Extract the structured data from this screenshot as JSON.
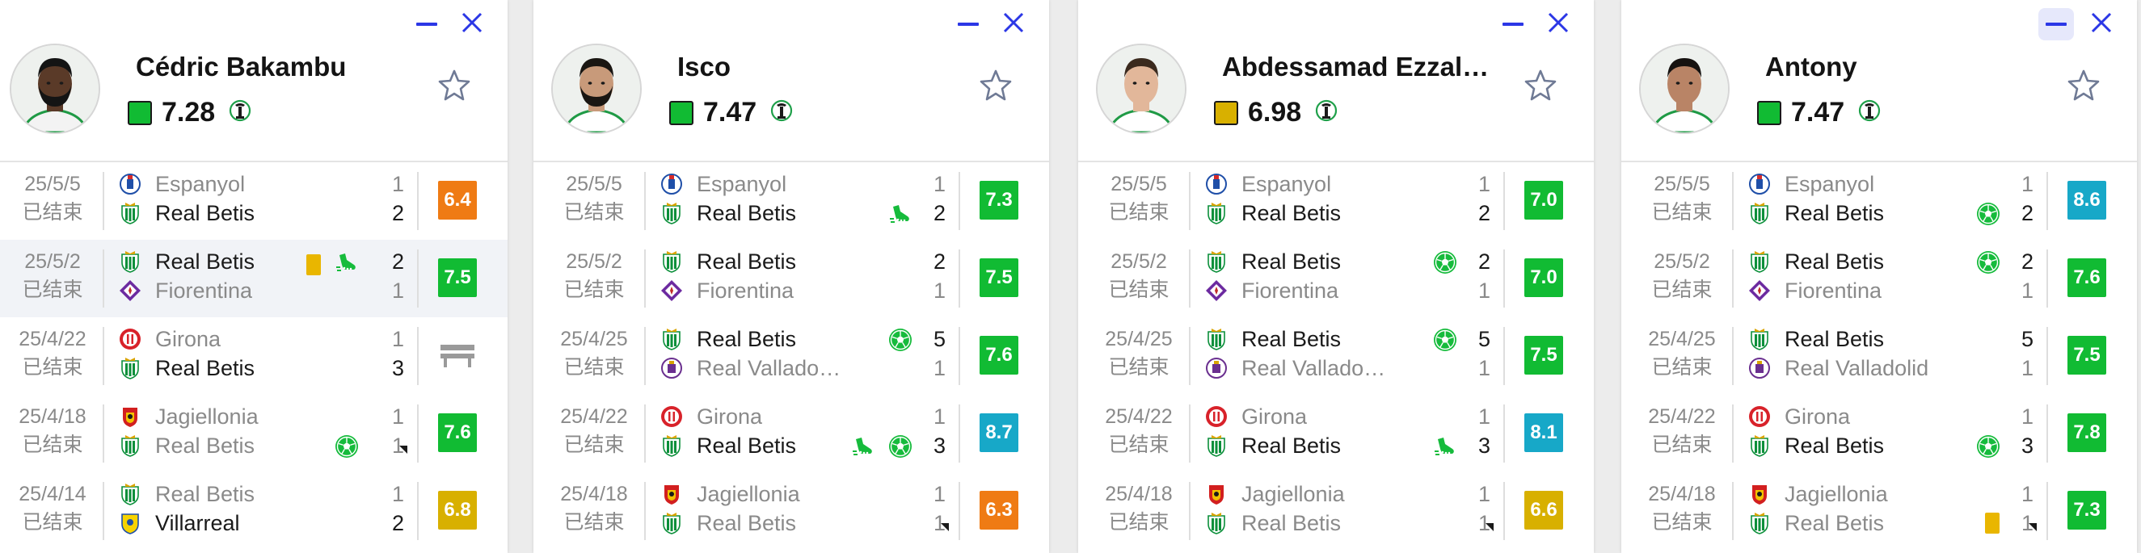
{
  "colors": {
    "green": "#11bb33",
    "bright_green": "#16bb3c",
    "teal": "#17a8c8",
    "orange": "#ef7b14",
    "yellow": "#d8b000",
    "yellow_card": "#e9b600",
    "accent_blue": "#2b37e6",
    "bench_gray": "#9a9a9a"
  },
  "icons": {
    "minimize": "minimize-icon",
    "close": "close-icon",
    "favorite": "star-outline-icon",
    "league": "conference-league-icon",
    "goal": "goal-ball-icon",
    "assist": "boot-assist-icon",
    "yellow_card": "yellow-card-icon",
    "bench": "bench-icon",
    "penalty_corner": "corner-flag-icon"
  },
  "players": [
    {
      "name": "Cédric Bakambu",
      "rating": "7.28",
      "rating_color": "#11bb33",
      "matches": [
        {
          "date": "25/5/5",
          "status": "已结束",
          "home": "Espanyol",
          "away": "Real Betis",
          "home_score": "1",
          "away_score": "2",
          "home_strong": false,
          "away_strong": true,
          "rating": "6.4",
          "badge_color": "#ef7b14",
          "events": [],
          "corner": false,
          "highlight": false
        },
        {
          "date": "25/5/2",
          "status": "已结束",
          "home": "Real Betis",
          "away": "Fiorentina",
          "home_score": "2",
          "away_score": "1",
          "home_strong": true,
          "away_strong": false,
          "rating": "7.5",
          "badge_color": "#11bb33",
          "events": [
            "yellow_card",
            "assist"
          ],
          "corner": false,
          "highlight": true
        },
        {
          "date": "25/4/22",
          "status": "已结束",
          "home": "Girona",
          "away": "Real Betis",
          "home_score": "1",
          "away_score": "3",
          "home_strong": false,
          "away_strong": true,
          "rating": "",
          "badge_color": "",
          "bench": true,
          "events": [],
          "corner": false,
          "highlight": false
        },
        {
          "date": "25/4/18",
          "status": "已结束",
          "home": "Jagiellonia",
          "away": "Real Betis",
          "home_score": "1",
          "away_score": "1",
          "home_strong": false,
          "away_strong": false,
          "rating": "7.6",
          "badge_color": "#11bb33",
          "events": [
            "goal"
          ],
          "corner": true,
          "highlight": false
        },
        {
          "date": "25/4/14",
          "status": "已结束",
          "home": "Real Betis",
          "away": "Villarreal",
          "home_score": "1",
          "away_score": "2",
          "home_strong": false,
          "away_strong": true,
          "rating": "6.8",
          "badge_color": "#d8b000",
          "events": [],
          "corner": false,
          "highlight": false
        }
      ]
    },
    {
      "name": "Isco",
      "rating": "7.47",
      "rating_color": "#11bb33",
      "matches": [
        {
          "date": "25/5/5",
          "status": "已结束",
          "home": "Espanyol",
          "away": "Real Betis",
          "home_score": "1",
          "away_score": "2",
          "home_strong": false,
          "away_strong": true,
          "rating": "7.3",
          "badge_color": "#11bb33",
          "events": [
            "assist"
          ],
          "corner": false,
          "highlight": false
        },
        {
          "date": "25/5/2",
          "status": "已结束",
          "home": "Real Betis",
          "away": "Fiorentina",
          "home_score": "2",
          "away_score": "1",
          "home_strong": true,
          "away_strong": false,
          "rating": "7.5",
          "badge_color": "#11bb33",
          "events": [],
          "corner": false,
          "highlight": false
        },
        {
          "date": "25/4/25",
          "status": "已结束",
          "home": "Real Betis",
          "away": "Real Vallado…",
          "home_score": "5",
          "away_score": "1",
          "home_strong": true,
          "away_strong": false,
          "rating": "7.6",
          "badge_color": "#11bb33",
          "events": [
            "goal_top"
          ],
          "corner": false,
          "highlight": false
        },
        {
          "date": "25/4/22",
          "status": "已结束",
          "home": "Girona",
          "away": "Real Betis",
          "home_score": "1",
          "away_score": "3",
          "home_strong": false,
          "away_strong": true,
          "rating": "8.7",
          "badge_color": "#17a8c8",
          "events": [
            "assist",
            "goal"
          ],
          "corner": false,
          "highlight": false
        },
        {
          "date": "25/4/18",
          "status": "已结束",
          "home": "Jagiellonia",
          "away": "Real Betis",
          "home_score": "1",
          "away_score": "1",
          "home_strong": false,
          "away_strong": false,
          "rating": "6.3",
          "badge_color": "#ef7b14",
          "events": [],
          "corner": true,
          "highlight": false
        }
      ]
    },
    {
      "name": "Abdessamad Ezzal…",
      "rating": "6.98",
      "rating_color": "#d8b000",
      "matches": [
        {
          "date": "25/5/5",
          "status": "已结束",
          "home": "Espanyol",
          "away": "Real Betis",
          "home_score": "1",
          "away_score": "2",
          "home_strong": false,
          "away_strong": true,
          "rating": "7.0",
          "badge_color": "#11bb33",
          "events": [],
          "corner": false,
          "highlight": false
        },
        {
          "date": "25/5/2",
          "status": "已结束",
          "home": "Real Betis",
          "away": "Fiorentina",
          "home_score": "2",
          "away_score": "1",
          "home_strong": true,
          "away_strong": false,
          "rating": "7.0",
          "badge_color": "#11bb33",
          "events": [
            "goal_top"
          ],
          "corner": false,
          "highlight": false
        },
        {
          "date": "25/4/25",
          "status": "已结束",
          "home": "Real Betis",
          "away": "Real Vallado…",
          "home_score": "5",
          "away_score": "1",
          "home_strong": true,
          "away_strong": false,
          "rating": "7.5",
          "badge_color": "#11bb33",
          "events": [
            "goal_top"
          ],
          "corner": false,
          "highlight": false
        },
        {
          "date": "25/4/22",
          "status": "已结束",
          "home": "Girona",
          "away": "Real Betis",
          "home_score": "1",
          "away_score": "3",
          "home_strong": false,
          "away_strong": true,
          "rating": "8.1",
          "badge_color": "#17a8c8",
          "events": [
            "assist"
          ],
          "corner": false,
          "highlight": false
        },
        {
          "date": "25/4/18",
          "status": "已结束",
          "home": "Jagiellonia",
          "away": "Real Betis",
          "home_score": "1",
          "away_score": "1",
          "home_strong": false,
          "away_strong": false,
          "rating": "6.6",
          "badge_color": "#d8b000",
          "events": [],
          "corner": true,
          "highlight": false
        }
      ]
    },
    {
      "name": "Antony",
      "rating": "7.47",
      "rating_color": "#11bb33",
      "minimize_highlight": true,
      "matches": [
        {
          "date": "25/5/5",
          "status": "已结束",
          "home": "Espanyol",
          "away": "Real Betis",
          "home_score": "1",
          "away_score": "2",
          "home_strong": false,
          "away_strong": true,
          "rating": "8.6",
          "badge_color": "#17a8c8",
          "events": [
            "goal"
          ],
          "corner": false,
          "highlight": false
        },
        {
          "date": "25/5/2",
          "status": "已结束",
          "home": "Real Betis",
          "away": "Fiorentina",
          "home_score": "2",
          "away_score": "1",
          "home_strong": true,
          "away_strong": false,
          "rating": "7.6",
          "badge_color": "#11bb33",
          "events": [
            "goal_top"
          ],
          "corner": false,
          "highlight": false
        },
        {
          "date": "25/4/25",
          "status": "已结束",
          "home": "Real Betis",
          "away": "Real Valladolid",
          "home_score": "5",
          "away_score": "1",
          "home_strong": true,
          "away_strong": false,
          "rating": "7.5",
          "badge_color": "#11bb33",
          "events": [],
          "corner": false,
          "highlight": false
        },
        {
          "date": "25/4/22",
          "status": "已结束",
          "home": "Girona",
          "away": "Real Betis",
          "home_score": "1",
          "away_score": "3",
          "home_strong": false,
          "away_strong": true,
          "rating": "7.8",
          "badge_color": "#11bb33",
          "events": [
            "goal"
          ],
          "corner": false,
          "highlight": false
        },
        {
          "date": "25/4/18",
          "status": "已结束",
          "home": "Jagiellonia",
          "away": "Real Betis",
          "home_score": "1",
          "away_score": "1",
          "home_strong": false,
          "away_strong": false,
          "rating": "7.3",
          "badge_color": "#11bb33",
          "events": [
            "yellow_card"
          ],
          "corner": true,
          "highlight": false
        }
      ]
    }
  ]
}
